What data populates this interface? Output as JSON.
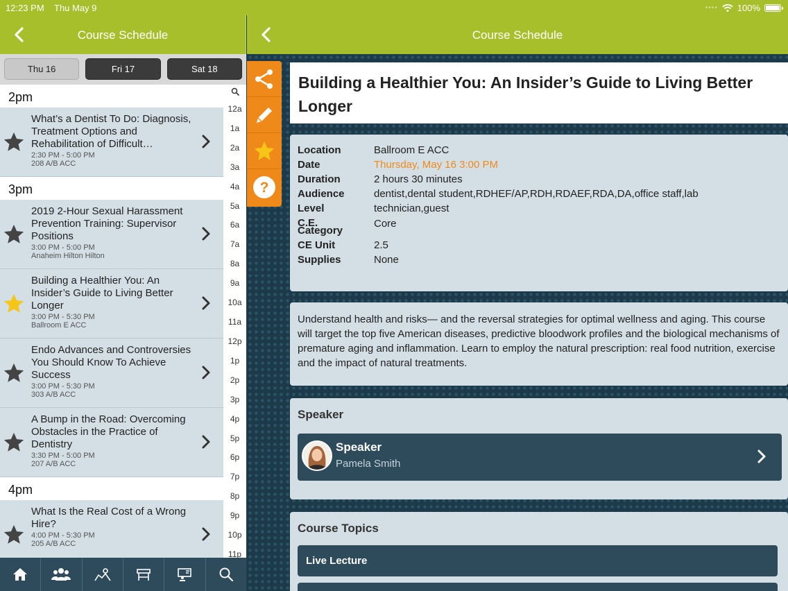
{
  "status_bar": {
    "time": "12:23 PM",
    "date": "Thu May 9",
    "battery": "100%"
  },
  "left_header": {
    "title": "Course Schedule"
  },
  "right_header": {
    "title": "Course Schedule"
  },
  "day_tabs": [
    {
      "label": "Thu 16",
      "active": true
    },
    {
      "label": "Fri 17",
      "active": false
    },
    {
      "label": "Sat 18",
      "active": false
    }
  ],
  "schedule": {
    "sections": [
      {
        "label": "2pm"
      },
      {
        "label": "3pm"
      },
      {
        "label": "4pm"
      }
    ],
    "items": [
      {
        "title": "What’s a Dentist To Do: Diagnosis, Treatment Options and Rehabilitation of Difficult…",
        "time": "2:30 PM - 5:00 PM",
        "location": "208 A/B ACC",
        "favorite": false
      },
      {
        "title": "2019 2-Hour Sexual Harassment Prevention Training: Supervisor Positions",
        "time": "3:00 PM - 5:00 PM",
        "location": "Anaheim Hilton Hilton",
        "favorite": false
      },
      {
        "title": "Building a Healthier You: An Insider’s Guide to Living Better Longer",
        "time": "3:00 PM - 5:30 PM",
        "location": "Ballroom E ACC",
        "favorite": true
      },
      {
        "title": "Endo Advances and Controversies You Should Know To Achieve Success",
        "time": "3:00 PM - 5:30 PM",
        "location": "303 A/B ACC",
        "favorite": false
      },
      {
        "title": "A Bump in the Road: Overcoming Obstacles in the Practice of Dentistry",
        "time": "3:30 PM - 5:00 PM",
        "location": "207 A/B ACC",
        "favorite": false
      },
      {
        "title": "What Is the Real Cost of a Wrong Hire?",
        "time": "4:00 PM - 5:30 PM",
        "location": "205 A/B ACC",
        "favorite": false
      }
    ]
  },
  "time_index": [
    "12a",
    "1a",
    "2a",
    "3a",
    "4a",
    "5a",
    "6a",
    "7a",
    "8a",
    "9a",
    "10a",
    "11a",
    "12p",
    "1p",
    "2p",
    "3p",
    "4p",
    "5p",
    "6p",
    "7p",
    "8p",
    "9p",
    "10p",
    "11p"
  ],
  "tab_bar": [
    {
      "icon": "home-icon"
    },
    {
      "icon": "people-icon"
    },
    {
      "icon": "map-icon"
    },
    {
      "icon": "exhibitor-booth-icon"
    },
    {
      "icon": "presenter-icon"
    },
    {
      "icon": "search-icon"
    }
  ],
  "action_bar": [
    {
      "icon": "share-icon"
    },
    {
      "icon": "pencil-icon"
    },
    {
      "icon": "star-icon"
    },
    {
      "icon": "help-icon"
    }
  ],
  "course": {
    "title": "Building a Healthier You: An Insider’s Guide to Living Better Longer",
    "details": {
      "location_label": "Location",
      "location": "Ballroom E ACC",
      "date_label": "Date",
      "date": "Thursday, May 16 3:00 PM",
      "duration_label": "Duration",
      "duration": "2 hours 30 minutes",
      "audience_label": "Audience",
      "audience_1": "dentist,dental student,RDHEF/AP,RDH,RDAEF,RDA,DA,office staff,lab",
      "level_label": "Level",
      "audience_2": "technician,guest",
      "ce_label": "C.E.",
      "category_label": "Category",
      "category": "Core",
      "ceunit_label": "CE Unit",
      "ceunit": "2.5",
      "supplies_label": "Supplies",
      "supplies": "None"
    },
    "description": "Understand health and risks— and the reversal strategies for optimal wellness and aging. This course will target the top five American diseases, predictive bloodwork profiles and the biological mechanisms of premature aging and inflammation. Learn to employ the natural prescription: real food nutrition, exercise and the impact of natural treatments.",
    "speaker_heading": "Speaker",
    "speaker": {
      "role": "Speaker",
      "name": "Pamela Smith"
    },
    "topics_heading": "Course Topics",
    "topics": [
      "Live Lecture"
    ]
  },
  "colors": {
    "header_green": "#a7bf2b",
    "accent_orange": "#ef8a1a",
    "navy": "#2d4b5b",
    "card_bg": "#d4dfe5"
  }
}
